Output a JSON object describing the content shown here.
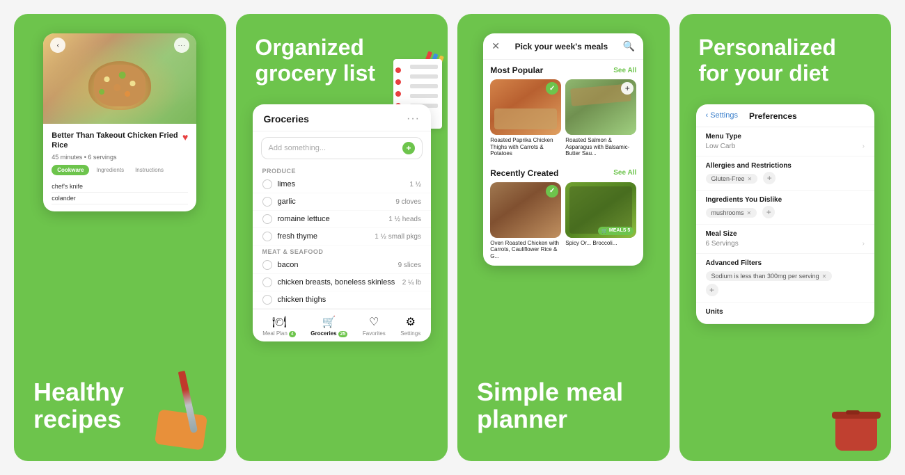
{
  "panel1": {
    "bottom_headline": "Healthy\nrecipes",
    "recipe": {
      "title": "Better Than Takeout Chicken Fried Rice",
      "meta": "45 minutes • 6 servings",
      "tabs": [
        "Cookware",
        "Ingredients",
        "Instructions"
      ],
      "active_tab": "Cookware",
      "items": [
        "chef's knife",
        "colander"
      ]
    },
    "nav": {
      "back": "‹",
      "dots": "···"
    }
  },
  "panel2": {
    "headline": "Organized\ngrocery list",
    "grocery": {
      "title": "Groceries",
      "dots": "···",
      "add_placeholder": "Add something...",
      "sections": [
        {
          "label": "PRODUCE",
          "items": [
            {
              "name": "limes",
              "qty": "1 ½"
            },
            {
              "name": "garlic",
              "qty": "9 cloves"
            },
            {
              "name": "romaine lettuce",
              "qty": "1 ½ heads"
            },
            {
              "name": "fresh thyme",
              "qty": "1 ½ small pkgs"
            }
          ]
        },
        {
          "label": "MEAT & SEAFOOD",
          "items": [
            {
              "name": "bacon",
              "qty": "9 slices"
            },
            {
              "name": "chicken breasts, boneless skinless",
              "qty": "2 ¼ lb"
            },
            {
              "name": "chicken thighs",
              "qty": ""
            }
          ]
        }
      ],
      "nav": [
        {
          "icon": "🍽",
          "label": "Meal Plan",
          "badge": "4",
          "active": false
        },
        {
          "icon": "🛒",
          "label": "Groceries",
          "badge": "25",
          "active": true
        },
        {
          "icon": "♡",
          "label": "Favorites",
          "badge": null,
          "active": false
        },
        {
          "icon": "⚙",
          "label": "Settings",
          "badge": null,
          "active": false
        }
      ]
    }
  },
  "panel3": {
    "headline": "Simple meal\nplanner",
    "modal": {
      "title": "Pick your week's meals",
      "sections": [
        {
          "title": "Most Popular",
          "see_all": "See All",
          "items": [
            {
              "name": "Roasted Paprika Chicken Thighs with Carrots & Potatoes",
              "checked": true,
              "color": "thumb-orange"
            },
            {
              "name": "Roasted Salmon & Asparagus with Balsamic-Butter Sau...",
              "checked": false,
              "color": "thumb-green"
            }
          ]
        },
        {
          "title": "Recently Created",
          "see_all": "See All",
          "items": [
            {
              "name": "Oven Roasted Chicken with Carrots, Cauliflower Rice & G...",
              "checked": true,
              "color": "thumb-brown"
            },
            {
              "name": "Spicy Or... Broccoli...",
              "checked": false,
              "color": "thumb-red",
              "badge": "MEALS 5"
            }
          ]
        }
      ]
    }
  },
  "panel4": {
    "headline": "Personalized\nfor your diet",
    "preferences": {
      "header": {
        "back": "‹ Settings",
        "title": "Preferences"
      },
      "rows": [
        {
          "title": "Menu Type",
          "value": "Low Carb",
          "has_chevron": true
        },
        {
          "title": "Allergies and Restrictions",
          "tags": [
            "Gluten-Free"
          ],
          "has_plus": true
        },
        {
          "title": "Ingredients You Dislike",
          "tags": [
            "mushrooms"
          ],
          "has_plus": true
        },
        {
          "title": "Meal Size",
          "value": "6 Servings",
          "has_chevron": true
        },
        {
          "title": "Advanced Filters",
          "filter_tag": "Sodium is less than 300mg per serving",
          "has_plus": true
        },
        {
          "title": "Units",
          "value": "",
          "has_chevron": false
        }
      ]
    }
  }
}
